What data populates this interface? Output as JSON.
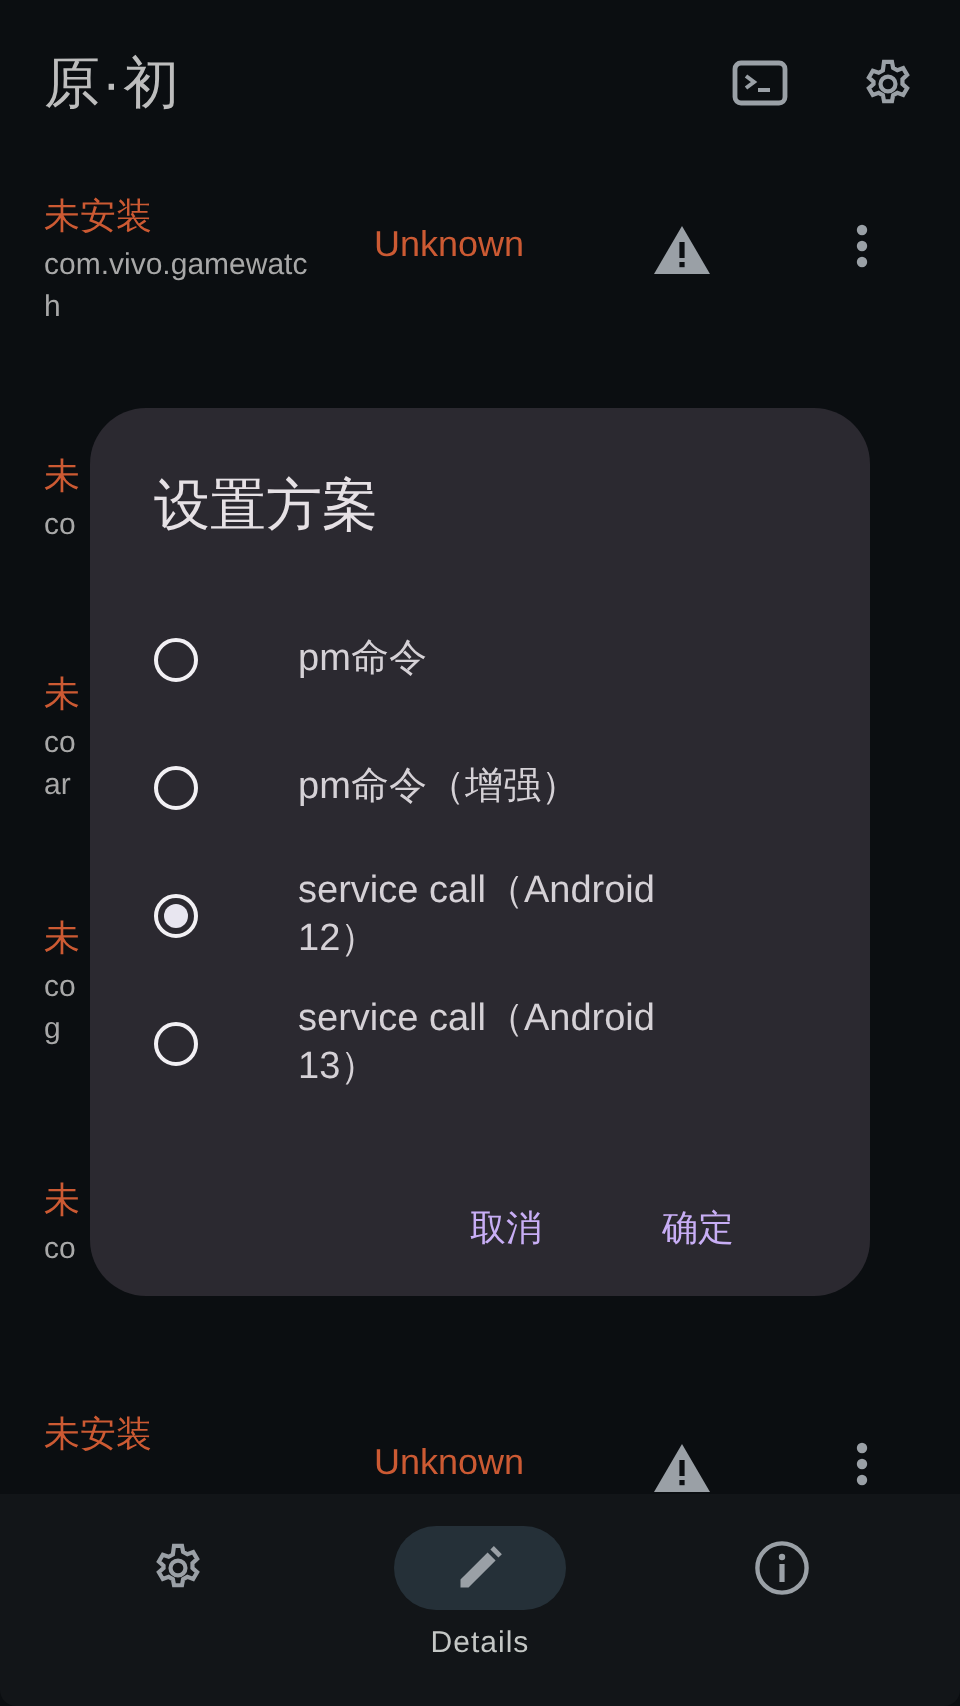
{
  "app_bar": {
    "title": "原·初"
  },
  "rows": [
    {
      "status": "未安装",
      "package": "com.vivo.gamewatch",
      "state": "Unknown"
    },
    {
      "status": "未",
      "package": "co"
    },
    {
      "status": "未",
      "package": "co\nar"
    },
    {
      "status": "未",
      "package": "co\ng"
    },
    {
      "status": "未",
      "package": "co"
    },
    {
      "status": "未安装",
      "state": "Unknown"
    }
  ],
  "dialog": {
    "title": "设置方案",
    "options": [
      {
        "label": "pm命令",
        "selected": false
      },
      {
        "label": "pm命令（增强）",
        "selected": false
      },
      {
        "label": "service call（Android 12）",
        "selected": true
      },
      {
        "label": "service call（Android 13）",
        "selected": false
      }
    ],
    "buttons": [
      "取消",
      "确定"
    ]
  },
  "bottom_nav": [
    {
      "kind": "settings",
      "selected": false
    },
    {
      "kind": "edit",
      "label": "Details",
      "selected": true
    },
    {
      "kind": "info",
      "selected": false
    }
  ]
}
